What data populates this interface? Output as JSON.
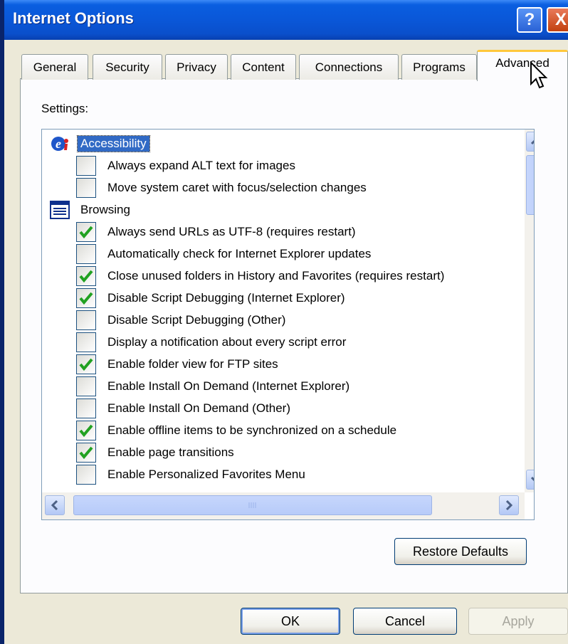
{
  "window": {
    "title": "Internet Options"
  },
  "title_buttons": {
    "help": "?",
    "close": "X"
  },
  "tabs": [
    {
      "label": "General"
    },
    {
      "label": "Security"
    },
    {
      "label": "Privacy"
    },
    {
      "label": "Content"
    },
    {
      "label": "Connections"
    },
    {
      "label": "Programs"
    },
    {
      "label": "Advanced",
      "active": true
    }
  ],
  "settings": {
    "label": "Settings:",
    "categories": [
      {
        "name": "Accessibility",
        "icon": "accessibility-icon",
        "selected": true,
        "items": [
          {
            "label": "Always expand ALT text for images",
            "checked": false
          },
          {
            "label": "Move system caret with focus/selection changes",
            "checked": false
          }
        ]
      },
      {
        "name": "Browsing",
        "icon": "browsing-list-icon",
        "selected": false,
        "items": [
          {
            "label": "Always send URLs as UTF-8 (requires restart)",
            "checked": true
          },
          {
            "label": "Automatically check for Internet Explorer updates",
            "checked": false
          },
          {
            "label": "Close unused folders in History and Favorites (requires restart)",
            "checked": true
          },
          {
            "label": "Disable Script Debugging (Internet Explorer)",
            "checked": true
          },
          {
            "label": "Disable Script Debugging (Other)",
            "checked": false
          },
          {
            "label": "Display a notification about every script error",
            "checked": false
          },
          {
            "label": "Enable folder view for FTP sites",
            "checked": true
          },
          {
            "label": "Enable Install On Demand (Internet Explorer)",
            "checked": false
          },
          {
            "label": "Enable Install On Demand (Other)",
            "checked": false
          },
          {
            "label": "Enable offline items to be synchronized on a schedule",
            "checked": true
          },
          {
            "label": "Enable page transitions",
            "checked": true
          },
          {
            "label": "Enable Personalized Favorites Menu",
            "checked": false
          }
        ]
      }
    ]
  },
  "buttons": {
    "restore_defaults": "Restore Defaults",
    "ok": "OK",
    "cancel": "Cancel",
    "apply": "Apply"
  },
  "colors": {
    "titlebar": "#0a57d8",
    "selection": "#316ac5",
    "checkmark": "#21a121",
    "tab_highlight": "#ffc83c"
  }
}
